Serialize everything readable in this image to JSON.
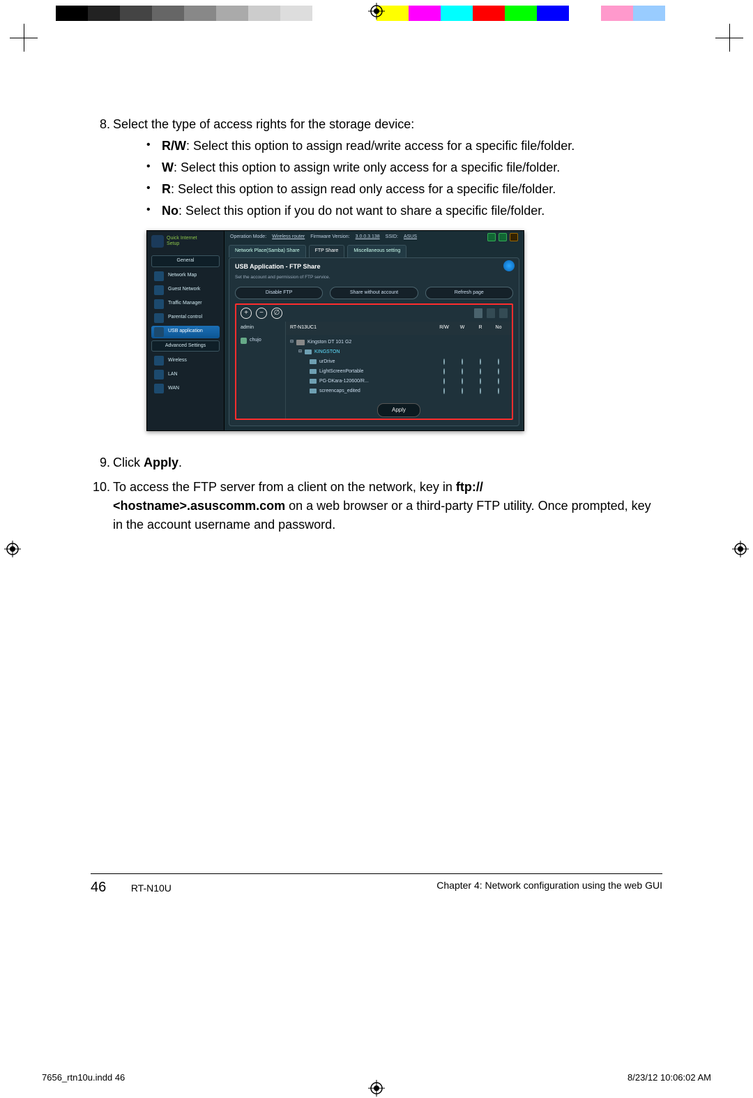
{
  "step8": {
    "num": "8.",
    "lead": "Select the type of access rights for the storage device:",
    "items": [
      {
        "b": "R/W",
        "t": ": Select this option to assign read/write access for a specific file/folder."
      },
      {
        "b": "W",
        "t": ": Select this option to assign write only access for a specific file/folder."
      },
      {
        "b": "R",
        "t": ": Select this option to assign read only access for a specific file/folder."
      },
      {
        "b": "No",
        "t": ": Select this option if you do not want to share a specific file/folder."
      }
    ]
  },
  "step9": {
    "num": "9.",
    "pre": "Click ",
    "b": "Apply",
    "post": "."
  },
  "step10": {
    "num": "10.",
    "pre": "To access the FTP server from a client on the network, key in ",
    "b1": "ftp://\n<hostname>.asuscomm.com",
    "post": " on a web browser or a third-party FTP utility. Once prompted, key in the account username and password."
  },
  "shot": {
    "qis": "Quick Internet\nSetup",
    "general": "General",
    "nav": [
      {
        "label": "Network Map"
      },
      {
        "label": "Guest Network"
      },
      {
        "label": "Traffic Manager"
      },
      {
        "label": "Parental control"
      },
      {
        "label": "USB application",
        "active": true
      }
    ],
    "adv": "Advanced Settings",
    "advnav": [
      {
        "label": "Wireless"
      },
      {
        "label": "LAN"
      },
      {
        "label": "WAN"
      }
    ],
    "status": {
      "opmode_l": "Operation Mode:",
      "opmode_v": "Wireless router",
      "fw_l": "Firmware Version:",
      "fw_v": "3.0.0.3.138",
      "ssid_l": "SSID:",
      "ssid_v": "ASUS"
    },
    "tabs": [
      "Network Place(Samba) Share",
      "FTP Share",
      "Miscellaneous setting"
    ],
    "activeTab": 1,
    "panel": {
      "title": "USB Application - FTP Share",
      "sub": "Set the account and permission of FTP service.",
      "buttons": [
        "Disable FTP",
        "Share without account",
        "Refresh page"
      ]
    },
    "users": {
      "header": "admin",
      "rows": [
        "chujo"
      ]
    },
    "fs": {
      "device": "RT-N13UC1",
      "cols": [
        "R/W",
        "W",
        "R",
        "No"
      ],
      "root": "Kingston DT 101 G2",
      "sel": "KINGSTON",
      "rows": [
        "urDrive",
        "LightScreenPortable",
        "PG-DKara-120600/R...",
        "screencaps_edited"
      ]
    },
    "apply": "Apply"
  },
  "footer": {
    "page": "46",
    "model": "RT-N10U",
    "chapter": "Chapter 4: Network configuration using the web GUI"
  },
  "indd": {
    "file": "7656_rtn10u.indd   46",
    "ts": "8/23/12   10:06:02 AM"
  },
  "colors": [
    "#000",
    "#222",
    "#444",
    "#666",
    "#888",
    "#aaa",
    "#ccc",
    "#ddd",
    "#fff",
    "#fff",
    "#ff0",
    "#f0f",
    "#0ff",
    "#f00",
    "#0f0",
    "#00f",
    "#fff",
    "#f9c",
    "#9cf",
    "#fff"
  ]
}
